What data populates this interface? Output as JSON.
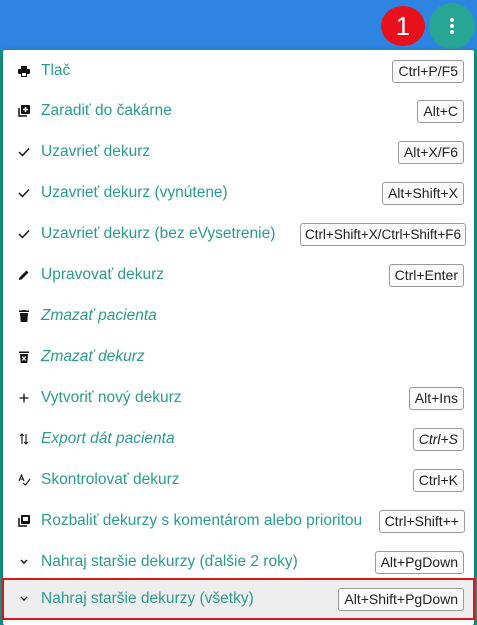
{
  "badge": "1",
  "colors": {
    "accent": "#2a9c8e",
    "topbar": "#2d84e1",
    "badge": "#e8101a",
    "highlight_border": "#d8161c"
  },
  "menu": {
    "items": [
      {
        "icon": "printer-icon",
        "label": "Tlač",
        "shortcut": "Ctrl+P/F5"
      },
      {
        "icon": "add-to-queue-icon",
        "label": "Zaradiť do čakárne",
        "shortcut": "Alt+C"
      },
      {
        "icon": "check-icon",
        "label": "Uzavrieť dekurz",
        "shortcut": "Alt+X/F6"
      },
      {
        "icon": "check-icon",
        "label": "Uzavrieť dekurz (vynútene)",
        "shortcut": "Alt+Shift+X"
      },
      {
        "icon": "check-icon",
        "label": "Uzavrieť dekurz (bez eVysetrenie)",
        "shortcut": "Ctrl+Shift+X/Ctrl+Shift+F6"
      },
      {
        "icon": "pencil-icon",
        "label": "Upravovať dekurz",
        "shortcut": "Ctrl+Enter"
      },
      {
        "icon": "trash-icon",
        "label": "Zmazať pacienta",
        "shortcut": ""
      },
      {
        "icon": "trash-x-icon",
        "label": "Zmazať dekurz",
        "shortcut": ""
      },
      {
        "icon": "plus-icon",
        "label": "Vytvoriť nový dekurz",
        "shortcut": "Alt+Ins"
      },
      {
        "icon": "swap-vertical-icon",
        "label": "Export dát pacienta",
        "shortcut": "Ctrl+S"
      },
      {
        "icon": "spellcheck-icon",
        "label": "Skontrolovať dekurz",
        "shortcut": "Ctrl+K"
      },
      {
        "icon": "collections-icon",
        "label": "Rozbaliť dekurzy s komentárom alebo prioritou",
        "shortcut": "Ctrl+Shift++"
      },
      {
        "icon": "chevron-down-icon",
        "label": "Nahraj staršie dekurzy (ďalšie 2 roky)",
        "shortcut": "Alt+PgDown"
      },
      {
        "icon": "chevron-down-icon",
        "label": "Nahraj staršie dekurzy (všetky)",
        "shortcut": "Alt+Shift+PgDown"
      }
    ]
  }
}
